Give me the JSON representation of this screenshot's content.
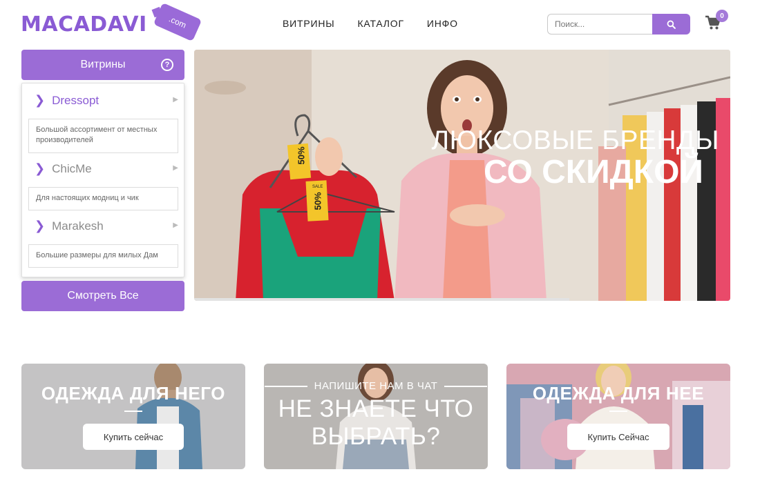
{
  "header": {
    "logo_text": "MACADAVI",
    "logo_tag": ".com",
    "nav": [
      "ВИТРИНЫ",
      "КАТАЛОГ",
      "ИНФО"
    ],
    "search_placeholder": "Поиск...",
    "cart_count": "0"
  },
  "sidebar": {
    "title": "Витрины",
    "help": "?",
    "shops": [
      {
        "name": "Dressopt",
        "desc": "Большой ассортимент от местных производителей",
        "color": "#8a5bd4"
      },
      {
        "name": "ChicMe",
        "desc": "Для настоящих модниц и чик",
        "color": "#8b8b8b"
      },
      {
        "name": "Marakesh",
        "desc": "Большие размеры для милых Дам",
        "color": "#8b8b8b"
      }
    ],
    "see_all": "Смотреть Все"
  },
  "hero": {
    "line1": "ЛЮКСОВЫЕ БРЕНДЫ",
    "line2": "СО СКИДКОЙ",
    "tag1": "50%",
    "tag2": "50%",
    "tag_sale": "SALE"
  },
  "cards": [
    {
      "title": "ОДЕЖДА ДЛЯ НЕГО",
      "button": "Купить сейчас"
    },
    {
      "subtitle": "НАПИШИТЕ НАМ В ЧАТ",
      "title_line1": "НЕ ЗНАЕТЕ ЧТО",
      "title_line2": "ВЫБРАТЬ?"
    },
    {
      "title": "ОДЕЖДА ДЛЯ НЕЕ",
      "button": "Купить Сейчас"
    }
  ],
  "colors": {
    "accent": "#9b6cd6",
    "logo": "#8a5bd4"
  }
}
